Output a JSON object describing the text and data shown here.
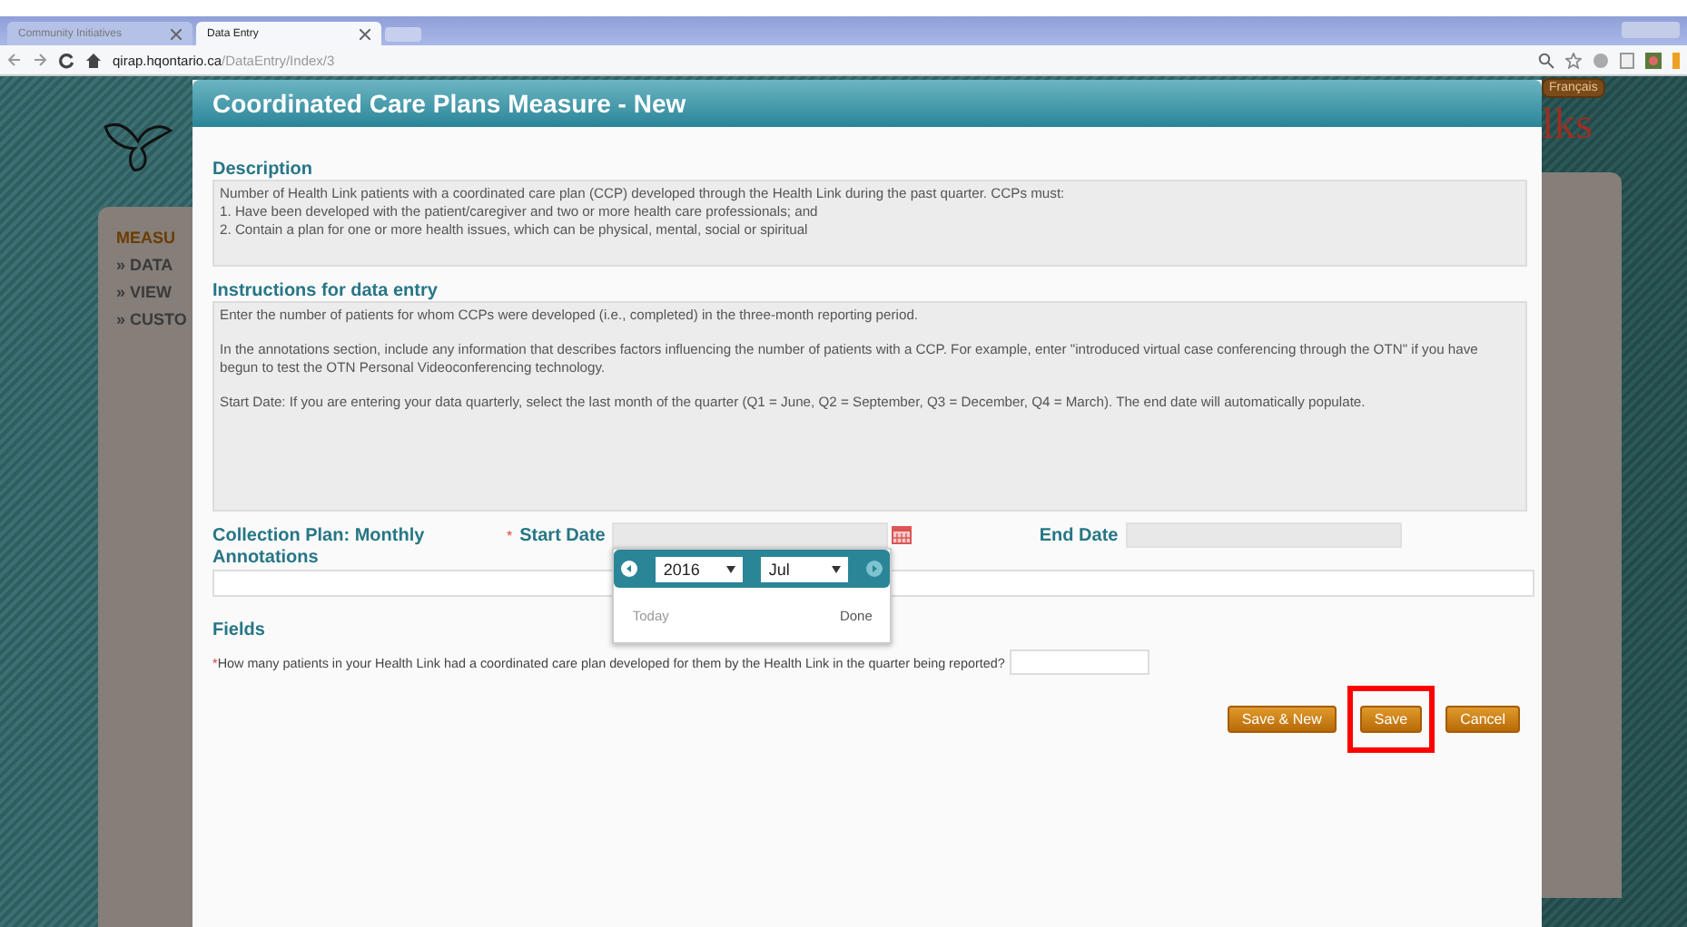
{
  "browser": {
    "tabs": [
      {
        "label": "Community Initiatives",
        "selected": false
      },
      {
        "label": "Data Entry",
        "selected": true
      }
    ],
    "url_host": "qirap.hqontario.ca",
    "url_path": "/DataEntry/Index/3"
  },
  "background": {
    "menu": [
      "MEASU",
      "» DATA",
      "» VIEW",
      "» CUSTO"
    ],
    "language_button": "Français",
    "logo_fragment": "lks"
  },
  "modal": {
    "title": "Coordinated Care Plans Measure - New",
    "description": {
      "heading": "Description",
      "lines": [
        "Number of Health Link patients with a coordinated care plan (CCP) developed through the Health Link during the past quarter.  CCPs must:",
        "1. Have been developed with the patient/caregiver and two or more health care professionals; and",
        "2. Contain a plan for one or more health issues, which can be physical, mental, social or spiritual"
      ]
    },
    "instructions": {
      "heading": "Instructions for data entry",
      "paragraphs": [
        "Enter the number of patients for whom CCPs were developed (i.e., completed) in the three-month reporting period.",
        "In the annotations section, include any information that describes factors influencing the number of patients with a CCP. For example, enter \"introduced virtual case conferencing through the OTN\" if you have begun to test the OTN Personal Videoconferencing technology.",
        "Start Date: If you are entering your data quarterly, select the last month of the quarter (Q1 = June, Q2 = September, Q3 =  December, Q4 = March). The end date will automatically populate."
      ]
    },
    "collection_plan": "Collection Plan: Monthly",
    "required_mark": "*",
    "start_date_label": "Start Date",
    "end_date_label": "End Date",
    "annotations_label": "Annotations",
    "datepicker": {
      "year": "2016",
      "month": "Jul",
      "today": "Today",
      "done": "Done"
    },
    "fields_heading": "Fields",
    "question_mark": "*",
    "question": "How many patients in your Health Link had a coordinated care plan developed for them by the Health Link in the quarter being reported?",
    "buttons": [
      {
        "label": "Save & New",
        "highlighted": false
      },
      {
        "label": "Save",
        "highlighted": true
      },
      {
        "label": "Cancel",
        "highlighted": false
      }
    ]
  }
}
